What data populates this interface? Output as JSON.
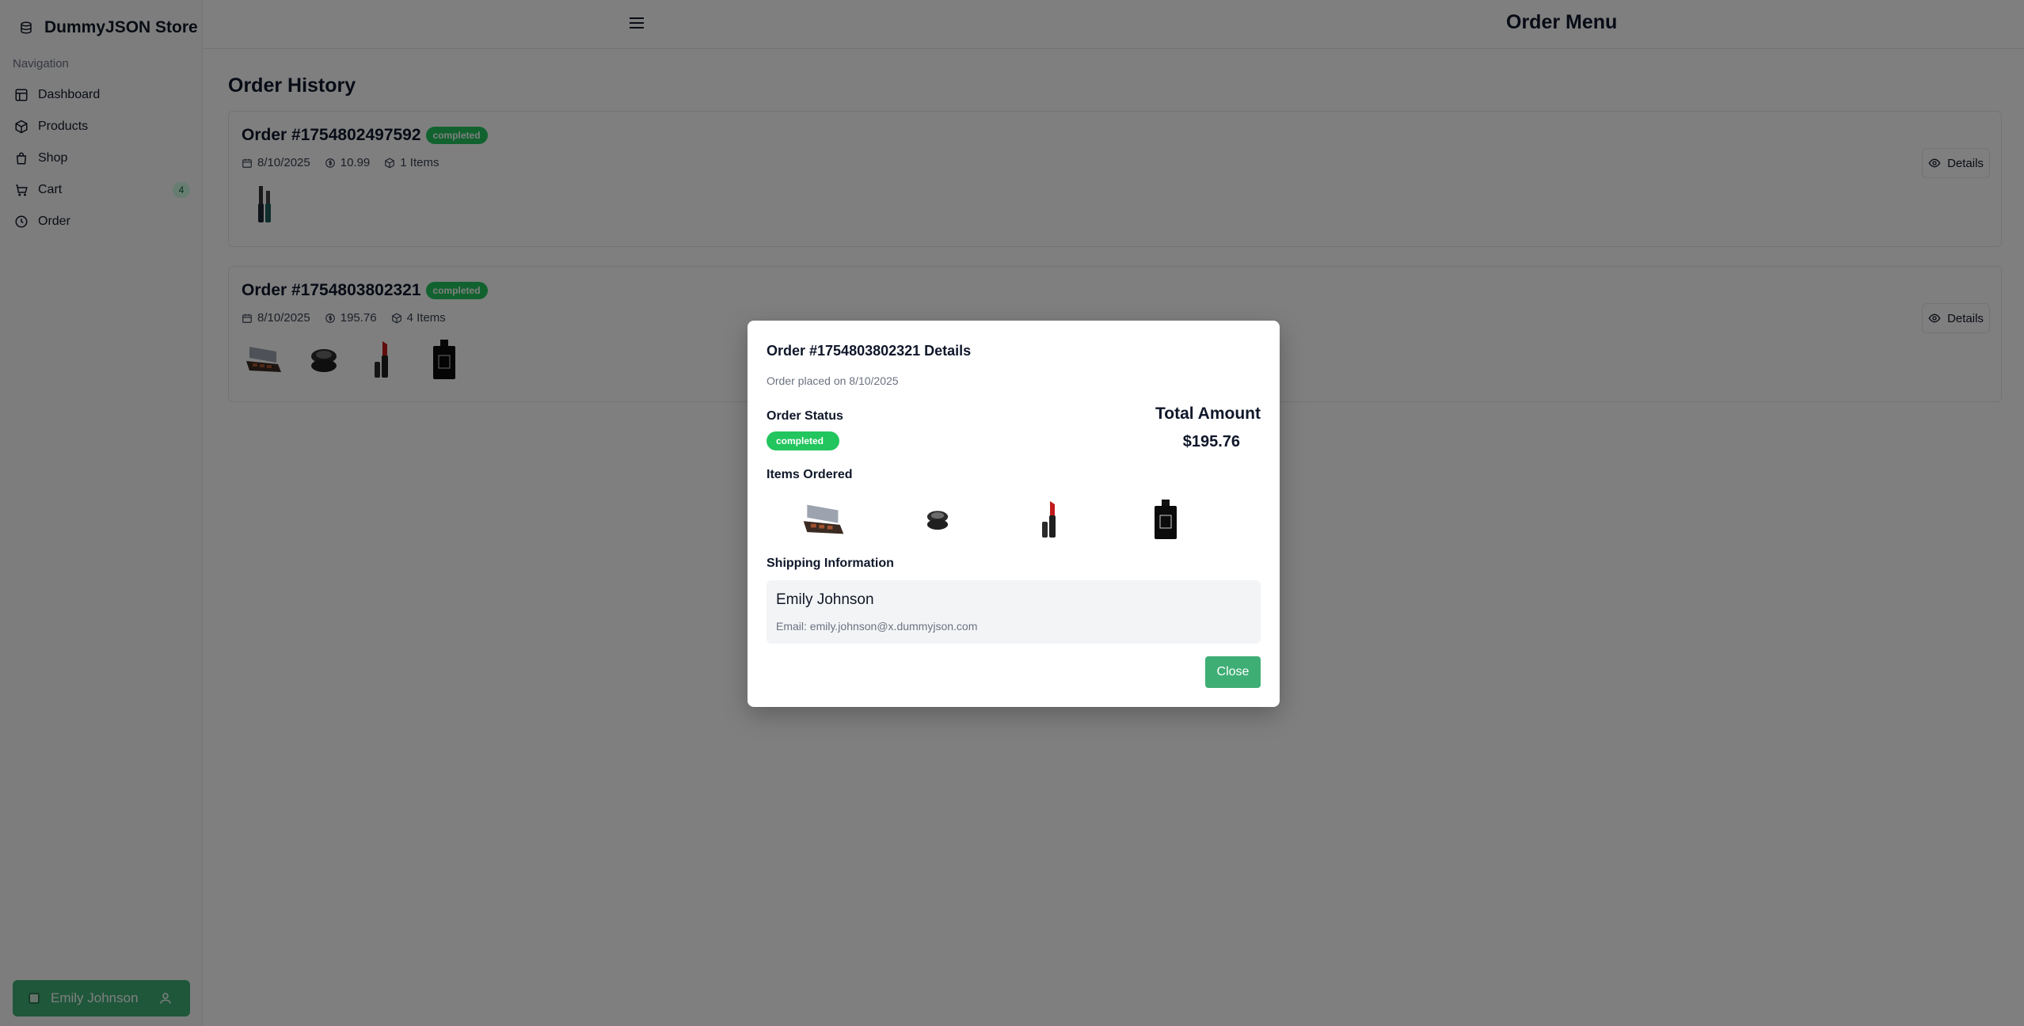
{
  "sidebar": {
    "brand": "DummyJSON Store",
    "nav_label": "Navigation",
    "items": [
      {
        "label": "Dashboard",
        "icon": "dashboard-icon"
      },
      {
        "label": "Products",
        "icon": "box-icon"
      },
      {
        "label": "Shop",
        "icon": "bag-icon"
      },
      {
        "label": "Cart",
        "icon": "cart-icon",
        "badge": "4"
      },
      {
        "label": "Order",
        "icon": "clock-icon"
      }
    ],
    "user": "Emily Johnson"
  },
  "header": {
    "title": "Order Menu"
  },
  "main": {
    "title": "Order History",
    "orders": [
      {
        "title": "Order #1754802497592",
        "status": "completed",
        "date": "8/10/2025",
        "amount": "10.99",
        "items": "1 Items",
        "details_label": "Details",
        "thumbnails": [
          "mascara"
        ]
      },
      {
        "title": "Order #1754803802321",
        "status": "completed",
        "date": "8/10/2025",
        "amount": "195.76",
        "items": "4 Items",
        "details_label": "Details",
        "thumbnails": [
          "eyeshadow-palette",
          "powder-compact",
          "lipstick",
          "perfume-bottle"
        ]
      }
    ]
  },
  "modal": {
    "title": "Order #1754803802321 Details",
    "subtitle": "Order placed on 8/10/2025",
    "status_label": "Order Status",
    "status": "completed",
    "total_label": "Total Amount",
    "total_value": "$195.76",
    "items_label": "Items Ordered",
    "items": [
      "eyeshadow-palette",
      "powder-compact",
      "lipstick",
      "perfume-bottle"
    ],
    "shipping_label": "Shipping Information",
    "shipping_name": "Emily Johnson",
    "shipping_email": "Email: emily.johnson@x.dummyjson.com",
    "close_label": "Close"
  },
  "colors": {
    "accent": "#3fae75",
    "status_green": "#22c55e",
    "overlay": "rgba(0,0,0,0.5)"
  }
}
